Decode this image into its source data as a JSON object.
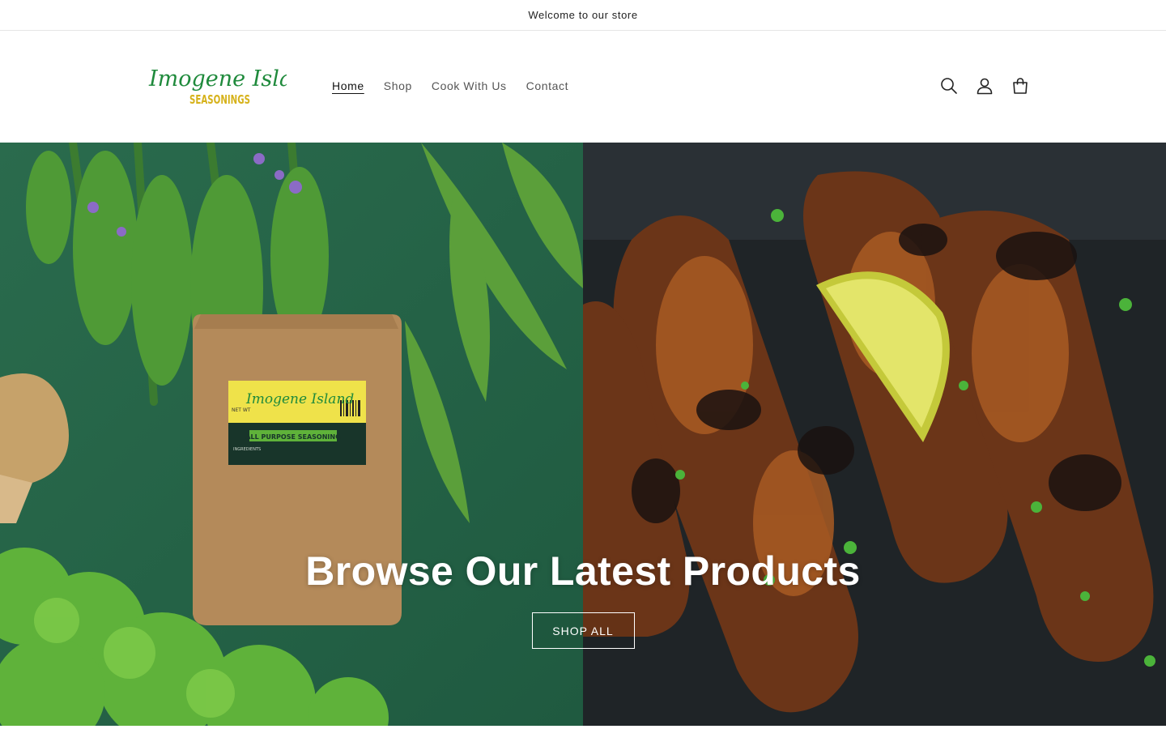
{
  "announcement": {
    "text": "Welcome to our store"
  },
  "header": {
    "logo": {
      "line1": "Imogene Island",
      "line2": "SEASONINGS"
    },
    "nav": [
      {
        "label": "Home",
        "active": true
      },
      {
        "label": "Shop",
        "active": false
      },
      {
        "label": "Cook With Us",
        "active": false
      },
      {
        "label": "Contact",
        "active": false
      }
    ],
    "icons": [
      "search-icon",
      "account-icon",
      "cart-icon"
    ]
  },
  "hero": {
    "title": "Browse Our Latest Products",
    "button_label": "SHOP ALL",
    "package_label": {
      "brand": "Imogene Island",
      "product": "ALL PURPOSE SEASONING",
      "net_wt": "NET WT",
      "ingredients": "INGREDIENTS"
    }
  },
  "colors": {
    "brand_green": "#1f8a3c",
    "brand_yellow": "#d6b21b",
    "hero_left_bg": "#2c6b4c",
    "hero_right_bg": "#1e2326"
  }
}
